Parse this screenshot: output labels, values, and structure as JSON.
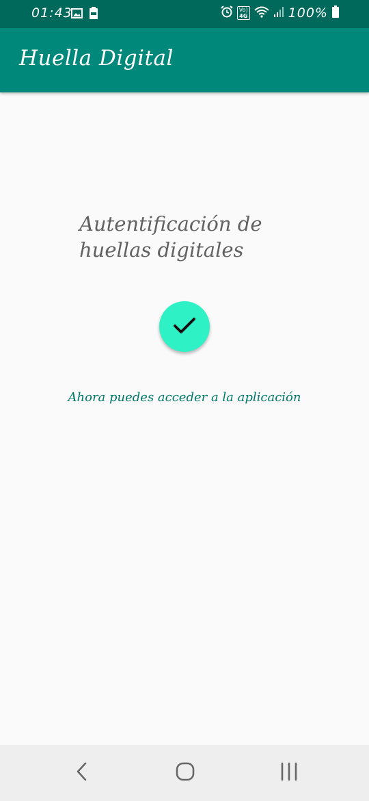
{
  "status_bar": {
    "time": "01:43",
    "battery_percent": "100%",
    "network_label_top": "Vo)",
    "network_label_bottom": "4G",
    "icons": [
      "image-icon",
      "battery-saver-icon",
      "alarm-icon",
      "volte-icon",
      "wifi-icon",
      "signal-icon",
      "battery-icon"
    ]
  },
  "app_bar": {
    "title": "Huella Digital"
  },
  "main": {
    "heading": "Autentificación de huellas digitales",
    "fab_icon": "check-icon",
    "fab_color": "#2ef2c5",
    "message": "Ahora puedes acceder a la aplicación"
  },
  "nav_bar": {
    "icons": [
      "back-icon",
      "home-icon",
      "recents-icon"
    ]
  },
  "colors": {
    "status_bar": "#00695c",
    "app_bar": "#00897b",
    "background": "#fafafa",
    "message_text": "#00796b"
  }
}
